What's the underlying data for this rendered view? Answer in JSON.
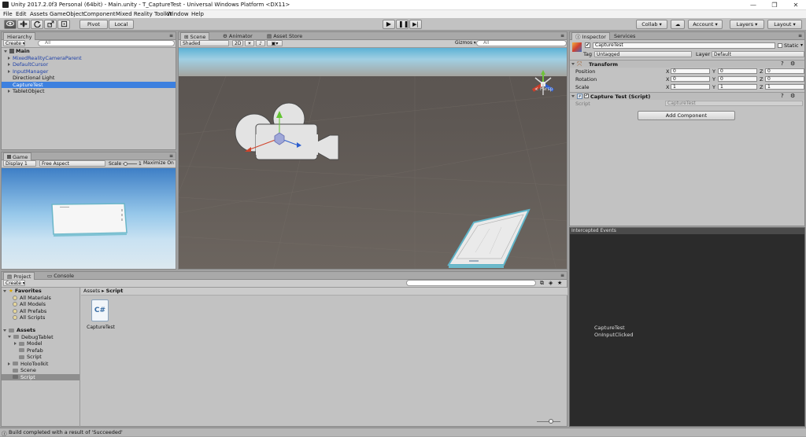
{
  "window": {
    "title": "Unity 2017.2.0f3 Personal (64bit) - Main.unity - T_CaptureTest - Universal Windows Platform <DX11>",
    "minimize": "—",
    "maximize": "❐",
    "close": "✕"
  },
  "menu": [
    "File",
    "Edit",
    "Assets",
    "GameObject",
    "Component",
    "Mixed Reality Toolkit",
    "Window",
    "Help"
  ],
  "toolbar": {
    "pivot": "Pivot",
    "local": "Local",
    "collab": "Collab ▾",
    "account": "Account ▾",
    "layers": "Layers ▾",
    "layout": "Layout ▾"
  },
  "hierarchy": {
    "tab": "Hierarchy",
    "create": "Create ▾",
    "search_placeholder": "All",
    "scene": "Main",
    "items": [
      {
        "label": "MixedRealityCameraParent",
        "expandable": true,
        "prefab": true
      },
      {
        "label": "DefaultCursor",
        "expandable": true,
        "prefab": true
      },
      {
        "label": "InputManager",
        "expandable": true,
        "prefab": true
      },
      {
        "label": "Directional Light",
        "expandable": false,
        "prefab": false
      },
      {
        "label": "CaptureTest",
        "expandable": false,
        "prefab": false,
        "selected": true
      },
      {
        "label": "TabletObject",
        "expandable": true,
        "prefab": false
      }
    ]
  },
  "scene_view": {
    "tabs": [
      "Scene",
      "Animator",
      "Asset Store"
    ],
    "active_tab": "Scene",
    "shading": "Shaded",
    "mode_2d": "2D",
    "gizmos": "Gizmos ▾",
    "search_placeholder": "All",
    "persp": "Persp"
  },
  "game_view": {
    "tab": "Game",
    "display": "Display 1",
    "aspect": "Free Aspect",
    "scale_label": "Scale",
    "scale_value": "1x",
    "maximize": "Maximize On Play"
  },
  "project": {
    "tabs": [
      "Project",
      "Console"
    ],
    "active_tab": "Project",
    "create": "Create ▾",
    "breadcrumb": [
      "Assets",
      "Script"
    ],
    "tree": [
      {
        "label": "Favorites",
        "level": 0,
        "type": "star",
        "bold": true,
        "expanded": true
      },
      {
        "label": "All Materials",
        "level": 1,
        "type": "search"
      },
      {
        "label": "All Models",
        "level": 1,
        "type": "search"
      },
      {
        "label": "All Prefabs",
        "level": 1,
        "type": "search"
      },
      {
        "label": "All Scripts",
        "level": 1,
        "type": "search"
      },
      {
        "label": "Assets",
        "level": 0,
        "type": "folder",
        "bold": true,
        "expanded": true
      },
      {
        "label": "DebugTablet",
        "level": 1,
        "type": "folder",
        "expanded": true
      },
      {
        "label": "Model",
        "level": 2,
        "type": "folder",
        "expandable": true
      },
      {
        "label": "Prefab",
        "level": 2,
        "type": "folder"
      },
      {
        "label": "Script",
        "level": 2,
        "type": "folder"
      },
      {
        "label": "HoloToolkit",
        "level": 1,
        "type": "folder",
        "expandable": true
      },
      {
        "label": "Scene",
        "level": 1,
        "type": "folder"
      },
      {
        "label": "Script",
        "level": 1,
        "type": "folder",
        "selected": true
      }
    ],
    "asset": {
      "label": "CaptureTest",
      "icon": "C#"
    }
  },
  "inspector": {
    "tabs": [
      "Inspector",
      "Services"
    ],
    "active_tab": "Inspector",
    "object_name": "CaptureTest",
    "static_label": "Static",
    "tag_label": "Tag",
    "tag_value": "Untagged",
    "layer_label": "Layer",
    "layer_value": "Default",
    "transform": {
      "title": "Transform",
      "rows": [
        {
          "label": "Position",
          "x": "0",
          "y": "0",
          "z": "0"
        },
        {
          "label": "Rotation",
          "x": "0",
          "y": "0",
          "z": "0"
        },
        {
          "label": "Scale",
          "x": "1",
          "y": "1",
          "z": "1"
        }
      ]
    },
    "script_component": {
      "title": "Capture Test (Script)",
      "field_label": "Script",
      "field_value": "CaptureTest"
    },
    "add_component": "Add Component"
  },
  "intercepted": {
    "title": "Intercepted Events",
    "lines": [
      "CaptureTest",
      "OnInputClicked"
    ]
  },
  "status": {
    "message": "Build completed with a result of 'Succeeded'"
  }
}
